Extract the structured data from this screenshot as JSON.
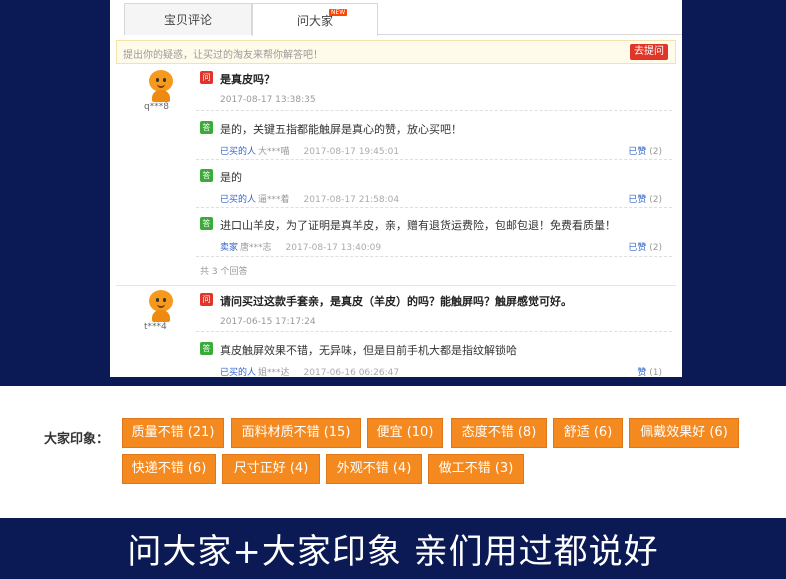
{
  "tabs": {
    "reviews": "宝贝评论",
    "ask_all": "问大家",
    "new_badge": "NEW"
  },
  "ask_bar": {
    "placeholder": "提出你的疑惑，让买过的淘友来帮你解答吧！",
    "button": "去提问"
  },
  "questions": [
    {
      "user": "q***8",
      "icon_q": "问",
      "text": "是真皮吗？",
      "time": "2017-08-17 13:38:35",
      "answers": [
        {
          "icon": "答",
          "text": "是的，关键五指都能触屏是真心的赞，放心买吧！",
          "role": "已买的人",
          "who": "大***喵",
          "time": "2017-08-17 19:45:01",
          "like_label": "已赞",
          "like_count": "(2)"
        },
        {
          "icon": "答",
          "text": "是的",
          "role": "已买的人",
          "who": "逼***着",
          "time": "2017-08-17 21:58:04",
          "like_label": "已赞",
          "like_count": "(2)"
        },
        {
          "icon": "答",
          "text": "进口山羊皮，为了证明是真羊皮，亲，赠有退货运费险，包邮包退！免费看质量！",
          "role": "卖家",
          "who": "唐***志",
          "time": "2017-08-17 13:40:09",
          "like_label": "已赞",
          "like_count": "(2)"
        }
      ],
      "answer_count": "共 3 个回答"
    },
    {
      "user": "t***4",
      "icon_q": "问",
      "text": "请问买过这款手套亲，是真皮（羊皮）的吗？能触屏吗？触屏感觉可好。",
      "time": "2017-06-15 17:17:24",
      "answers": [
        {
          "icon": "答",
          "text": "真皮触屏效果不错，无异味，但是目前手机大都是指纹解锁哈",
          "role": "已买的人",
          "who": "姐***达",
          "time": "2017-06-16 06:26:47",
          "like_label": "赞",
          "like_count": "(1)"
        }
      ]
    }
  ],
  "impression": {
    "label": "大家印象：",
    "tags": [
      "质量不错 (21)",
      "面料材质不错 (15)",
      "便宜 (10)",
      "态度不错 (8)",
      "舒适 (6)",
      "佩戴效果好 (6)",
      "快递不错 (6)",
      "尺寸正好 (4)",
      "外观不错 (4)",
      "做工不错 (3)"
    ]
  },
  "banner": {
    "text": "问大家+大家印象 亲们用过都说好"
  },
  "colors": {
    "background": "#0b1a55",
    "tag": "#f48a1f",
    "question_icon": "#e0352b",
    "answer_icon": "#3aaa3a",
    "link": "#3366cc"
  }
}
